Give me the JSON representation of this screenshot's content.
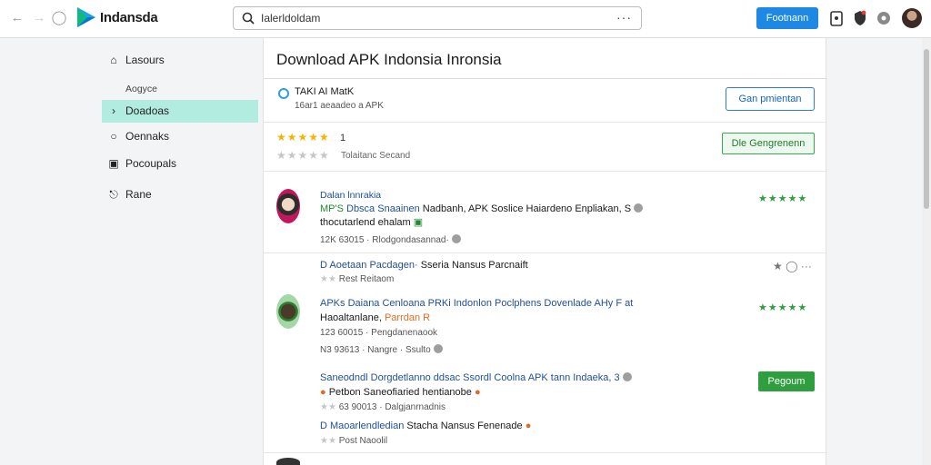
{
  "topbar": {
    "app_name": "Indansda",
    "search_text": "Ialerldoldam",
    "search_more": "···",
    "primary_button": "Footnann"
  },
  "sidebar": {
    "items": [
      {
        "label": "Lasours",
        "icon": "home-icon"
      },
      {
        "label": "Doadoas",
        "icon": "chevron-right-icon"
      },
      {
        "label": "Oennaks",
        "icon": "circle-icon"
      },
      {
        "label": "Pocoupals",
        "icon": "square-icon"
      },
      {
        "label": "Rane",
        "icon": "lock-icon"
      }
    ],
    "heading": "Aogyce",
    "active_index": 1
  },
  "main": {
    "title": "Download APK Indonsia Inronsia",
    "app": {
      "name": "TAKI AI MatK",
      "sub": "16ar1 aeaadeo a APK",
      "button": "Gan pmientan"
    },
    "rating": {
      "count": "1",
      "sub": "Tolaitanc Secand",
      "button": "Dle Gengrenenn",
      "value": 5
    },
    "reviews": [
      {
        "title": "Dalan lnnrakia",
        "line1_a": "MP'S",
        "line1_b": "Dbsca Snaainen",
        "line1_c": "Nadbanh, APK Soslice Haiardeno Enpliakan, S",
        "line2": "thocutarlend ehalam",
        "meta": "12K  63015  ·  Rlodgondasannad·"
      },
      {
        "line1_a": "D",
        "line1_b": "Aoetaan Pacdagen·",
        "line1_c": "Sseria Nansus Parcnaift",
        "meta": "Rest Reitaom"
      },
      {
        "line1": "APKs Daiana Cenloana PRKi Indonlon Poclphens Dovenlade AHy F at",
        "line2_a": "Haoaltanlane,",
        "line2_b": "Parrdan R",
        "meta1": "123  60015  ·  Pengdanenaook",
        "meta2": "N3 93613  ·  Nangre ·  Ssulto"
      },
      {
        "line1": "Saneodndl Dorgdetlanno ddsac Ssordl Coolna APK tann Indaeka, 3",
        "line2": "Petbon Saneofiaried hentianobe",
        "meta": "63 90013  ·  Dalgjanrnadnis",
        "button": "Pegoum"
      },
      {
        "line1_a": "D",
        "line1_b": "Maoarlendledian",
        "line1_c": "Stacha Nansus Fenenade",
        "meta": "Post Naoolil"
      }
    ]
  },
  "colors": {
    "accent": "#1e88e5",
    "sidebar_active": "#b2ece0",
    "green": "#2e9e3e",
    "star_gold": "#f2b500"
  }
}
